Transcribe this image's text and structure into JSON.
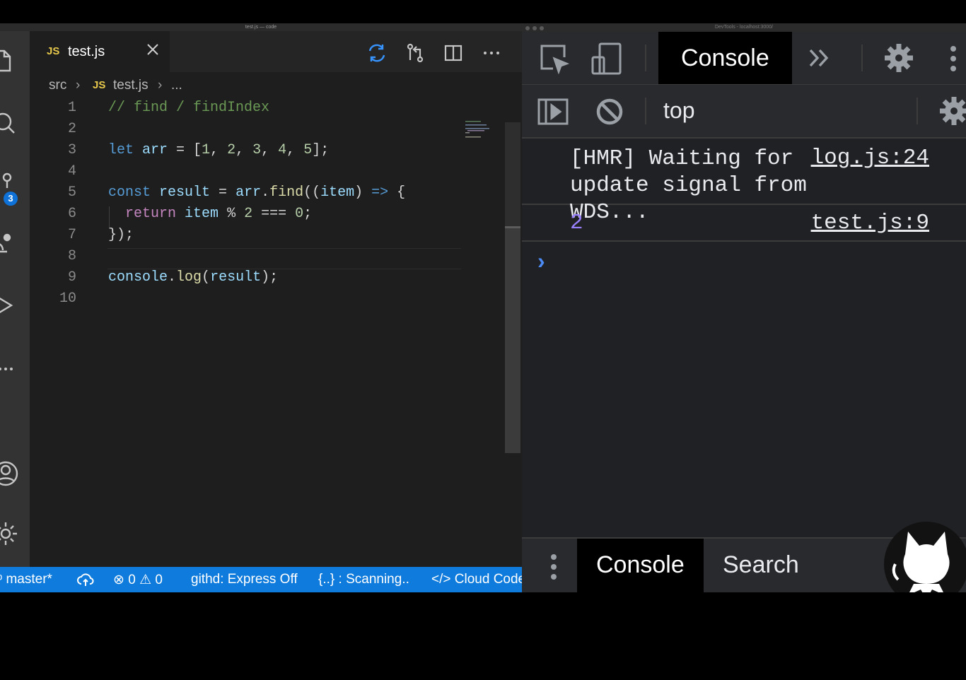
{
  "vscode": {
    "window_title": "test.js — code",
    "activity_badge": "3",
    "tab": {
      "lang_tag": "JS",
      "label": "test.js"
    },
    "breadcrumb": {
      "folder": "src",
      "lang_tag": "JS",
      "file": "test.js",
      "more": "..."
    },
    "code": {
      "line_numbers": [
        "1",
        "2",
        "3",
        "4",
        "5",
        "6",
        "7",
        "8",
        "9",
        "10"
      ],
      "l1": "// find / findIndex",
      "l3": {
        "kw": "let",
        "var": "arr",
        "eq": " = [",
        "n1": "1",
        "n2": "2",
        "n3": "3",
        "n4": "4",
        "n5": "5",
        "end": "];",
        "sep": ", "
      },
      "l5": {
        "kw": "const",
        "var": "result",
        "eq": " = ",
        "obj": "arr",
        "dot": ".",
        "fn": "find",
        "open": "((",
        "param": "item",
        "close": ") ",
        "arrow": "=>",
        "brace": " {"
      },
      "l6": {
        "kw": "return",
        "var": "item",
        "op1": " % ",
        "n1": "2",
        "op2": " === ",
        "n2": "0",
        "end": ";"
      },
      "l7": "});",
      "l9": {
        "obj": "console",
        "dot": ".",
        "fn": "log",
        "open": "(",
        "arg": "result",
        "end": ");"
      }
    },
    "status": {
      "branch": "master*",
      "errors": "0",
      "warnings": "0",
      "githd": "githd: Express Off",
      "scanning": "{..} : Scanning..",
      "cloud": "Cloud Code"
    }
  },
  "devtools": {
    "window_title": "DevTools - localhost:3000/",
    "console_tab": "Console",
    "context": "top",
    "messages": [
      {
        "text": "[HMR] Waiting for update signal from WDS...",
        "source": "log.js:24"
      },
      {
        "text": "2",
        "source": "test.js:9"
      }
    ],
    "prompt": "›",
    "drawer": {
      "console_tab": "Console",
      "search_tab": "Search"
    }
  },
  "colors": {
    "statusbar": "#0f7bdc",
    "number_output": "#9980ff",
    "badge": "#0e72d8"
  }
}
